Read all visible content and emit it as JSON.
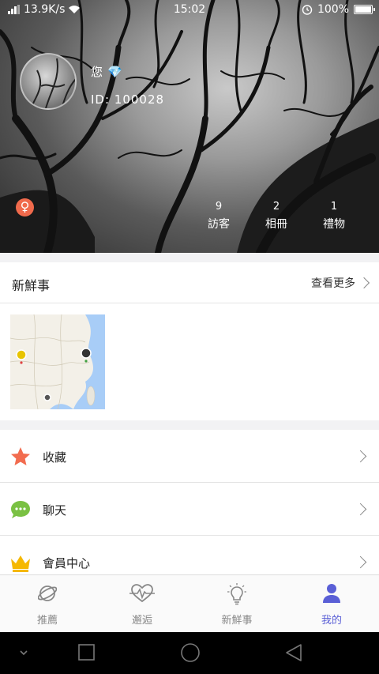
{
  "status_bar": {
    "speed": "13.9K/s",
    "time": "15:02",
    "battery": "100%"
  },
  "profile": {
    "nickname": "您",
    "id_label": "ID: 100028",
    "gender_symbol": "♀"
  },
  "stats": [
    {
      "value": "9",
      "label": "訪客"
    },
    {
      "value": "2",
      "label": "相冊"
    },
    {
      "value": "1",
      "label": "禮物"
    }
  ],
  "whats_new": {
    "title": "新鮮事",
    "more": "查看更多"
  },
  "menu": [
    {
      "label": "收藏",
      "icon": "star-icon",
      "color": "#f26c4f"
    },
    {
      "label": "聊天",
      "icon": "chat-bubble-icon",
      "color": "#7ac143"
    },
    {
      "label": "會員中心",
      "icon": "crown-icon",
      "color": "#f5b800"
    }
  ],
  "tabs": [
    {
      "label": "推薦",
      "icon": "planet-icon"
    },
    {
      "label": "邂逅",
      "icon": "heartbeat-icon"
    },
    {
      "label": "新鮮事",
      "icon": "lightbulb-icon"
    },
    {
      "label": "我的",
      "icon": "person-icon",
      "active": true
    }
  ],
  "colors": {
    "accent": "#5a5fd6",
    "gender": "#f06a4c"
  }
}
